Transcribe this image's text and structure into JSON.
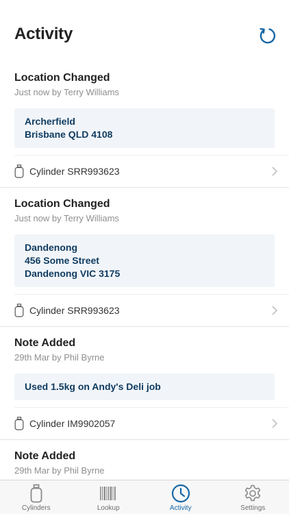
{
  "header": {
    "title": "Activity"
  },
  "colors": {
    "accent": "#1566a5",
    "detail_text": "#0e3a5f",
    "detail_bg": "#f1f5f9"
  },
  "feed": [
    {
      "title": "Location Changed",
      "subtitle": "Just now by Terry Williams",
      "lines": [
        "Archerfield",
        "Brisbane QLD 4108"
      ],
      "link": "Cylinder SRR993623"
    },
    {
      "title": "Location Changed",
      "subtitle": "Just now by Terry Williams",
      "lines": [
        "Dandenong",
        "456 Some Street",
        "Dandenong VIC 3175"
      ],
      "link": "Cylinder SRR993623"
    },
    {
      "title": "Note Added",
      "subtitle": "29th Mar by Phil Byrne",
      "lines": [
        "Used 1.5kg on Andy's Deli job"
      ],
      "link": "Cylinder IM9902057"
    },
    {
      "title": "Note Added",
      "subtitle": "29th Mar by Phil Byrne",
      "lines": [],
      "link": ""
    }
  ],
  "tabs": [
    {
      "label": "Cylinders",
      "icon": "cylinder-icon",
      "active": false
    },
    {
      "label": "Lookup",
      "icon": "barcode-icon",
      "active": false
    },
    {
      "label": "Activity",
      "icon": "clock-icon",
      "active": true
    },
    {
      "label": "Settings",
      "icon": "gear-icon",
      "active": false
    }
  ]
}
